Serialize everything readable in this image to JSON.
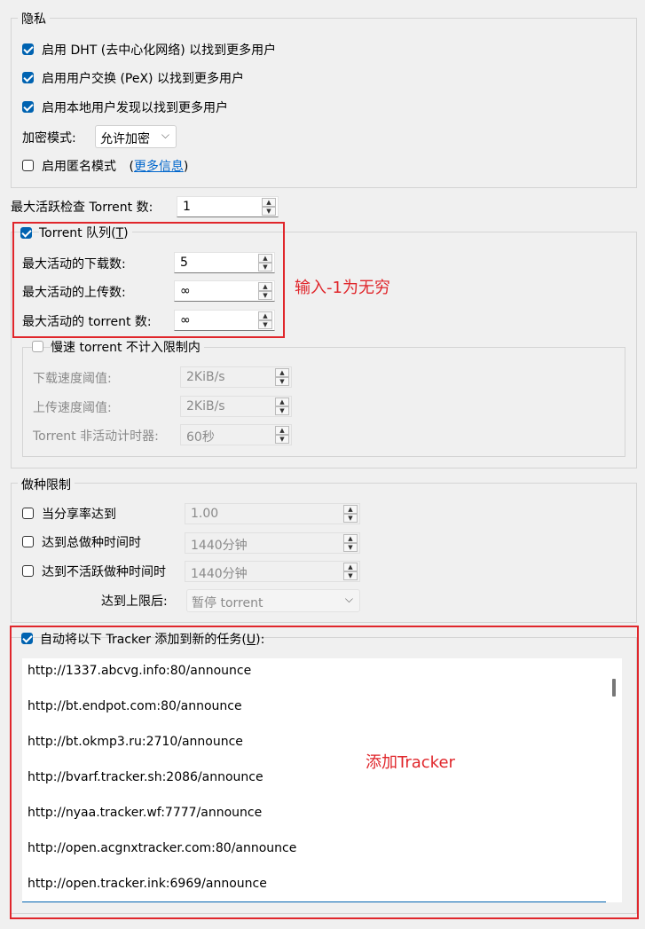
{
  "privacy": {
    "title": "隐私",
    "dht": "启用 DHT (去中心化网络) 以找到更多用户",
    "pex": "启用用户交换 (PeX) 以找到更多用户",
    "lsd": "启用本地用户发现以找到更多用户",
    "encryption_label": "加密模式:",
    "encryption_value": "允许加密",
    "anonymous": "启用匿名模式",
    "paren_open": "(",
    "more_info": "更多信息",
    "paren_close": ")"
  },
  "checking": {
    "label": "最大活跃检查 Torrent 数:",
    "value": "1"
  },
  "queue": {
    "title_prefix": "Torrent 队列(",
    "title_key": "T",
    "title_suffix": ")",
    "max_downloads_label": "最大活动的下载数:",
    "max_downloads_value": "5",
    "max_uploads_label": "最大活动的上传数:",
    "max_uploads_value": "∞",
    "max_torrents_label": "最大活动的 torrent 数:",
    "max_torrents_value": "∞",
    "slow": {
      "title": "慢速 torrent 不计入限制内",
      "dl_label": "下载速度阈值:",
      "dl_value": "2KiB/s",
      "ul_label": "上传速度阈值:",
      "ul_value": "2KiB/s",
      "timer_label": "Torrent 非活动计时器:",
      "timer_value": "60秒"
    }
  },
  "seeding": {
    "title": "做种限制",
    "ratio_label": "当分享率达到",
    "ratio_value": "1.00",
    "time_label": "达到总做种时间时",
    "time_value": "1440分钟",
    "inactive_label": "达到不活跃做种时间时",
    "inactive_value": "1440分钟",
    "action_label": "达到上限后:",
    "action_value": "暂停 torrent"
  },
  "trackers": {
    "title_prefix": "自动将以下 Tracker 添加到新的任务(",
    "title_key": "U",
    "title_suffix": "):",
    "list": [
      "http://1337.abcvg.info:80/announce",
      "http://bt.endpot.com:80/announce",
      "http://bt.okmp3.ru:2710/announce",
      "http://bvarf.tracker.sh:2086/announce",
      "http://nyaa.tracker.wf:7777/announce",
      "http://open.acgnxtracker.com:80/announce",
      "http://open.tracker.ink:6969/announce"
    ]
  },
  "annotations": {
    "queue_note": "输入-1为无穷",
    "tracker_note": "添加Tracker",
    "color": "#e0262b"
  },
  "colors": {
    "accent": "#0063b1",
    "link": "#0066cc"
  }
}
